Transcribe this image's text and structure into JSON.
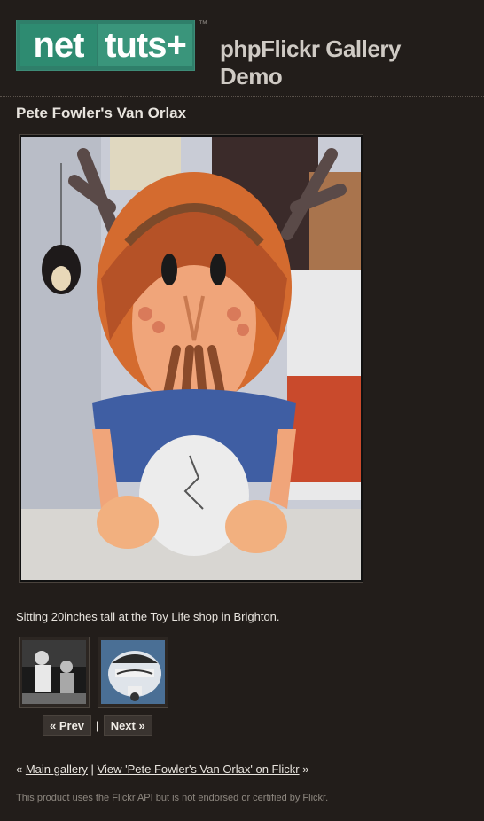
{
  "header": {
    "logo_net": "net",
    "logo_tuts": "tuts+",
    "trademark": "™",
    "site_title": "phpFlickr Gallery Demo"
  },
  "photo": {
    "title": "Pete Fowler's Van Orlax",
    "caption_prefix": "Sitting 20inches tall at the ",
    "caption_link": "Toy Life",
    "caption_suffix": " shop in Brighton."
  },
  "pager": {
    "prev": "« Prev",
    "separator": "|",
    "next": "Next »"
  },
  "footer": {
    "lead": "« ",
    "main_gallery": "Main gallery",
    "separator": " | ",
    "view_on_flickr": "View 'Pete Fowler's Van Orlax' on Flickr",
    "trail": " »",
    "disclaimer": "This product uses the Flickr API but is not endorsed or certified by Flickr."
  }
}
